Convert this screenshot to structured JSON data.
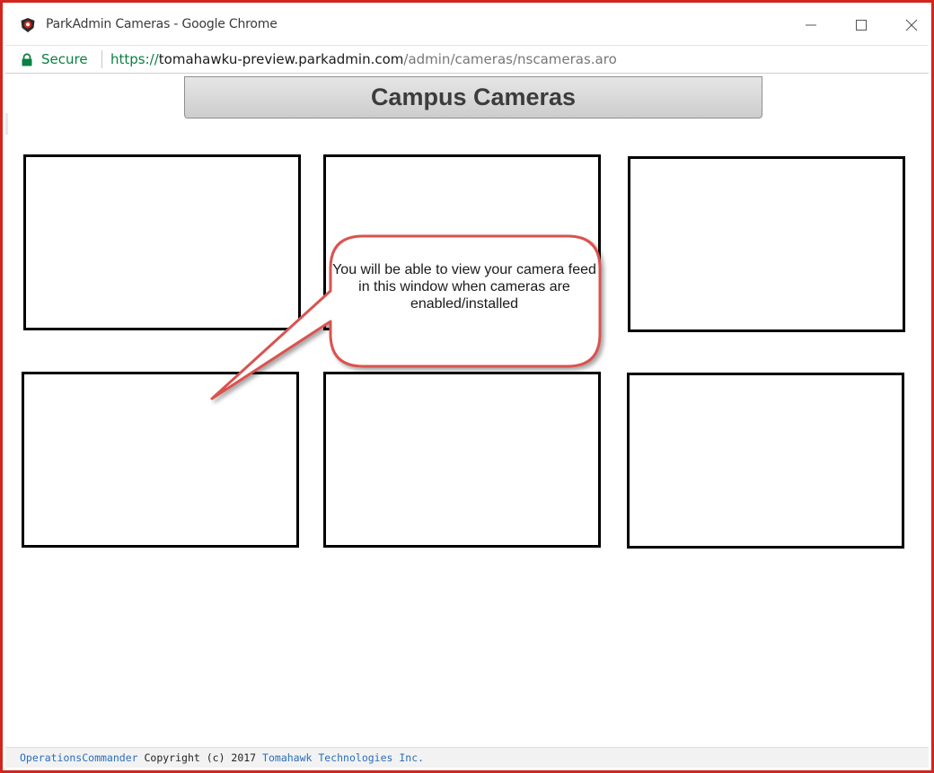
{
  "window": {
    "title": "ParkAdmin Cameras - Google Chrome",
    "app_icon": "parkadmin-shield-icon"
  },
  "address_bar": {
    "security_label": "Secure",
    "url_scheme": "https://",
    "url_host": "tomahawku-preview.parkadmin.com",
    "url_path": "/admin/cameras/nscameras.aro"
  },
  "page": {
    "header_title": "Campus Cameras",
    "camera_count": 6,
    "callout_text": "You will be able to view your camera feed in this window when cameras are enabled/installed"
  },
  "footer": {
    "product_link": "OperationsCommander",
    "copyright": " Copyright (c) 2017 ",
    "company_link": "Tomahawk Technologies Inc."
  },
  "colors": {
    "frame_border": "#d0261e",
    "secure_green": "#0b8043",
    "link_blue": "#2a6ebb",
    "callout_border": "#d9534f"
  }
}
